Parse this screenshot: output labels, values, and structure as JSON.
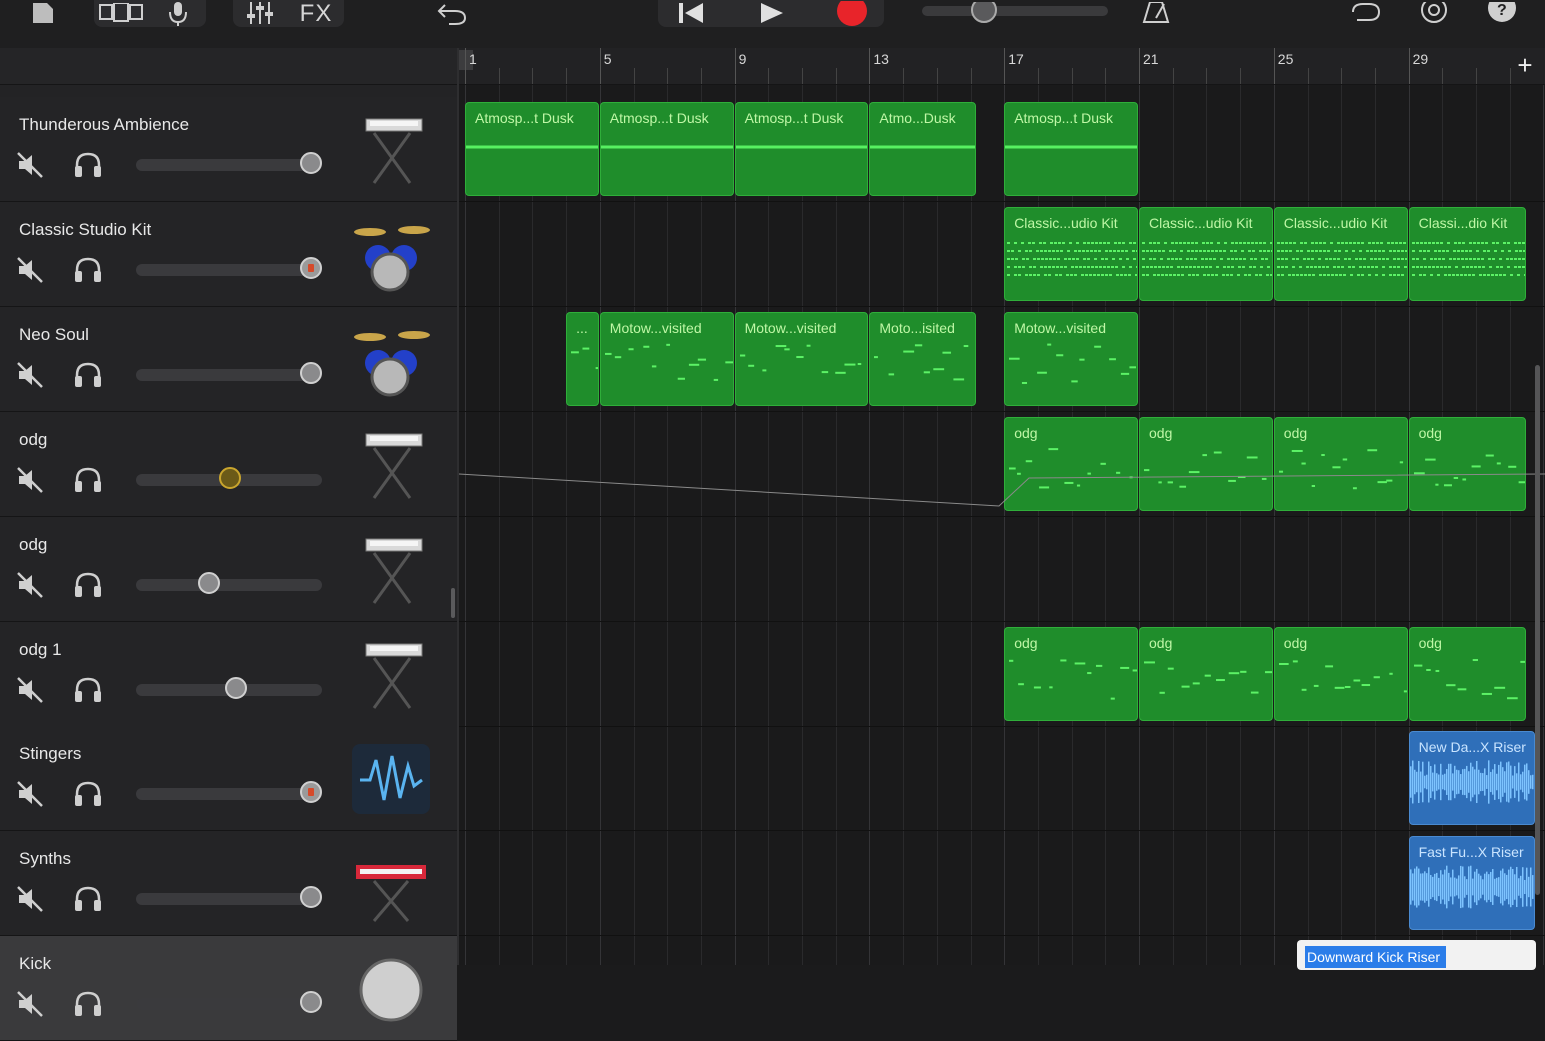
{
  "toolbar": {
    "fx_label": "FX",
    "record_color": "#e8242a",
    "icons": [
      "document-icon",
      "track-view-icon",
      "microphone-icon",
      "mixer-icon",
      "fx-icon",
      "undo-icon",
      "rewind-icon",
      "play-icon",
      "record-icon",
      "master-volume-slider",
      "metronome-icon",
      "loop-icon",
      "settings-icon",
      "help-icon"
    ]
  },
  "ruler": {
    "bars": [
      "1",
      "5",
      "9",
      "13",
      "17",
      "21",
      "25",
      "29"
    ],
    "add_label": "+"
  },
  "tracks": [
    {
      "name": "Thunderous Ambience",
      "instrument": "keyboard-stand-icon",
      "volume": 1.0,
      "knob": "normal"
    },
    {
      "name": "Classic Studio Kit",
      "instrument": "drum-kit-icon",
      "volume": 1.0,
      "knob": "rec"
    },
    {
      "name": "Neo Soul",
      "instrument": "drum-kit-icon",
      "volume": 1.0,
      "knob": "normal"
    },
    {
      "name": "odg",
      "instrument": "keyboard-stand-icon",
      "volume": 0.5,
      "knob": "gold"
    },
    {
      "name": "odg",
      "instrument": "keyboard-stand-icon",
      "volume": 0.37,
      "knob": "normal"
    },
    {
      "name": "odg 1",
      "instrument": "keyboard-stand-icon",
      "volume": 0.54,
      "knob": "normal"
    },
    {
      "name": "Stingers",
      "instrument": "waveform-icon",
      "volume": 1.0,
      "knob": "rec"
    },
    {
      "name": "Synths",
      "instrument": "red-synth-icon",
      "volume": 1.0,
      "knob": "normal"
    },
    {
      "name": "Kick",
      "instrument": "kick-drum-icon",
      "volume": 1.0,
      "knob": "normal"
    }
  ],
  "regions": {
    "lane0": [
      {
        "label": "Atmosp...t Dusk",
        "start": 1,
        "end": 5
      },
      {
        "label": "Atmosp...t Dusk",
        "start": 5,
        "end": 9
      },
      {
        "label": "Atmosp...t Dusk",
        "start": 9,
        "end": 13
      },
      {
        "label": "Atmo...Dusk",
        "start": 13,
        "end": 16.2
      },
      {
        "label": "Atmosp...t Dusk",
        "start": 17,
        "end": 21
      }
    ],
    "lane1": [
      {
        "label": "Classic...udio Kit",
        "start": 17,
        "end": 21
      },
      {
        "label": "Classic...udio Kit",
        "start": 21,
        "end": 25
      },
      {
        "label": "Classic...udio Kit",
        "start": 25,
        "end": 29
      },
      {
        "label": "Classi...dio Kit",
        "start": 29,
        "end": 32.5
      }
    ],
    "lane2": [
      {
        "label": "...",
        "start": 4,
        "end": 5
      },
      {
        "label": "Motow...visited",
        "start": 5,
        "end": 9
      },
      {
        "label": "Motow...visited",
        "start": 9,
        "end": 13
      },
      {
        "label": "Moto...isited",
        "start": 13,
        "end": 16.2
      },
      {
        "label": "Motow...visited",
        "start": 17,
        "end": 21
      }
    ],
    "lane3": [
      {
        "label": "odg",
        "start": 17,
        "end": 21
      },
      {
        "label": "odg",
        "start": 21,
        "end": 25
      },
      {
        "label": "odg",
        "start": 25,
        "end": 29
      },
      {
        "label": "odg",
        "start": 29,
        "end": 32.5
      }
    ],
    "lane5": [
      {
        "label": "odg",
        "start": 17,
        "end": 21
      },
      {
        "label": "odg",
        "start": 21,
        "end": 25
      },
      {
        "label": "odg",
        "start": 25,
        "end": 29
      },
      {
        "label": "odg",
        "start": 29,
        "end": 32.5
      }
    ],
    "lane6": [
      {
        "label": "New Da...X Riser",
        "start": 29,
        "end": 33
      }
    ],
    "lane7": [
      {
        "label": "Fast Fu...X Riser",
        "start": 29,
        "end": 33
      }
    ]
  },
  "tooltip": {
    "text": "Downward Kick Riser"
  },
  "colors": {
    "midi_region": "#1f8d2b",
    "audio_region": "#2f6fb9",
    "midi_text": "#bff7a6"
  }
}
